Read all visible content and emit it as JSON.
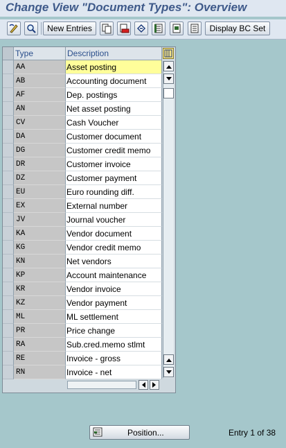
{
  "window": {
    "title": "Change View \"Document Types\": Overview"
  },
  "toolbar": {
    "new_entries_label": "New Entries",
    "display_bc_set_label": "Display BC Set",
    "icons": [
      "display-change-icon",
      "other-view-icon",
      "copy-icon",
      "delete-icon",
      "undo-icon",
      "select-all-icon",
      "select-block-icon",
      "deselect-all-icon"
    ]
  },
  "table": {
    "columns": [
      "Type",
      "Description"
    ],
    "selected_row": 0,
    "rows": [
      {
        "type": "AA",
        "description": "Asset posting"
      },
      {
        "type": "AB",
        "description": "Accounting document"
      },
      {
        "type": "AF",
        "description": "Dep. postings"
      },
      {
        "type": "AN",
        "description": "Net asset posting"
      },
      {
        "type": "CV",
        "description": "Cash Voucher"
      },
      {
        "type": "DA",
        "description": "Customer document"
      },
      {
        "type": "DG",
        "description": "Customer credit memo"
      },
      {
        "type": "DR",
        "description": "Customer invoice"
      },
      {
        "type": "DZ",
        "description": "Customer payment"
      },
      {
        "type": "EU",
        "description": "Euro rounding diff."
      },
      {
        "type": "EX",
        "description": "External number"
      },
      {
        "type": "JV",
        "description": "Journal voucher"
      },
      {
        "type": "KA",
        "description": "Vendor document"
      },
      {
        "type": "KG",
        "description": "Vendor credit memo"
      },
      {
        "type": "KN",
        "description": "Net vendors"
      },
      {
        "type": "KP",
        "description": "Account maintenance"
      },
      {
        "type": "KR",
        "description": "Vendor invoice"
      },
      {
        "type": "KZ",
        "description": "Vendor payment"
      },
      {
        "type": "ML",
        "description": "ML settlement"
      },
      {
        "type": "PR",
        "description": "Price change"
      },
      {
        "type": "RA",
        "description": "Sub.cred.memo stlmt"
      },
      {
        "type": "RE",
        "description": "Invoice - gross"
      },
      {
        "type": "RN",
        "description": "Invoice - net"
      }
    ]
  },
  "footer": {
    "position_label": "Position...",
    "entry_info": "Entry 1 of 38"
  },
  "colors": {
    "background": "#a5c7cb",
    "title": "#3f5a8a",
    "selected_cell": "#fffe9a",
    "header_text": "#2b4f8c"
  }
}
